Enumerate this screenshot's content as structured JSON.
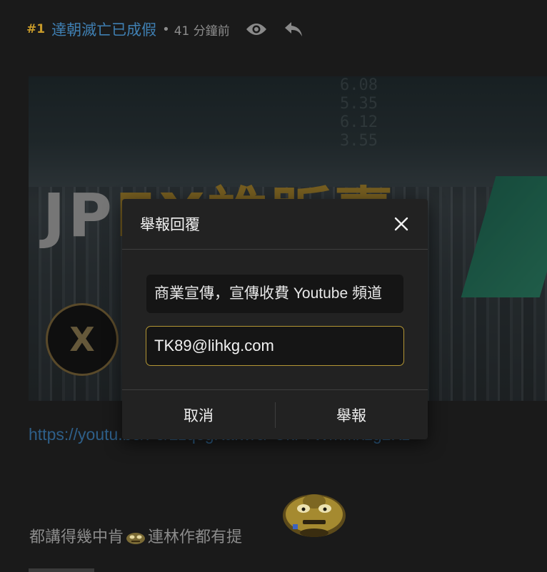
{
  "post": {
    "number": "#1",
    "username": "達朝滅亡已成假",
    "separator": "•",
    "time": "41 分鐘前",
    "icons": [
      "eye-icon",
      "reply-icon"
    ]
  },
  "thumbnail": {
    "title_white": "JP",
    "title_yellow": "EX誰販賣",
    "logo_letter": "X",
    "ticker": [
      "6.08",
      "5.35",
      "6.12",
      "3.55"
    ]
  },
  "link_text": "https://youtu.be/Fe/2zqegKaIwrc/-UkF7WmMxzg2Kz",
  "body_text": {
    "before_emoji": "都講得幾中肯",
    "after_emoji": "連林作都有提"
  },
  "modal": {
    "title": "舉報回覆",
    "reason_value": "商業宣傳，宣傳收費 Youtube 頻道",
    "email_value": "TK89@lihkg.com",
    "cancel_label": "取消",
    "report_label": "舉報"
  },
  "colors": {
    "accent": "#b39634",
    "number": "#c79a2a",
    "username": "#3f7fb2",
    "link": "#2e5f89"
  }
}
